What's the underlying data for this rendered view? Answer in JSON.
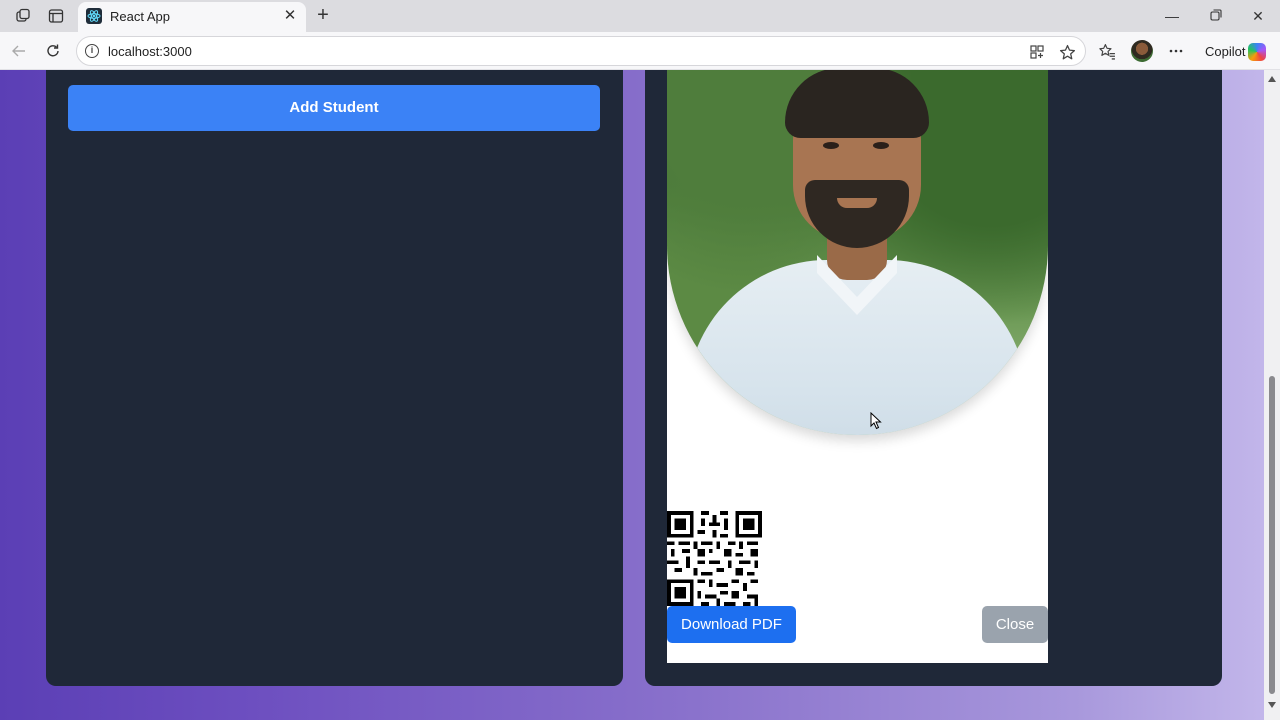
{
  "browser": {
    "tab_title": "React App",
    "url": "localhost:3000",
    "copilot_label": "Copilot",
    "icons": [
      "workspaces-icon",
      "tab-actions-icon",
      "react-favicon-icon",
      "close-icon",
      "new-tab-icon",
      "minimize-icon",
      "restore-icon",
      "window-close-icon",
      "back-icon",
      "refresh-icon",
      "info-icon",
      "app-available-icon",
      "favorite-star-icon",
      "favorites-icon",
      "profile-avatar",
      "more-icon",
      "copilot-icon"
    ]
  },
  "page": {
    "add_student_label": "Add Student",
    "download_pdf_label": "Download PDF",
    "close_label": "Close",
    "colors": {
      "panel": "#1f2838",
      "primary_button": "#3b82f6",
      "download_button": "#1d6ff0",
      "close_button": "#9aa3ad",
      "background_from": "#5b3fb5",
      "background_to": "#c2b6ea"
    }
  }
}
